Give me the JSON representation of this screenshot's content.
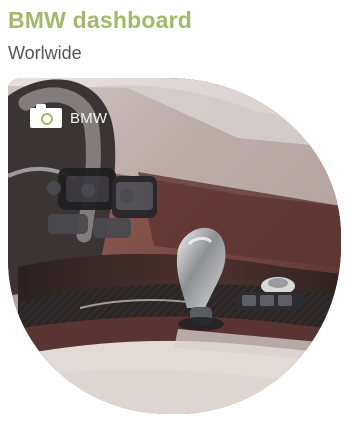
{
  "header": {
    "title": "BMW dashboard",
    "subtitle": "Worlwide"
  },
  "photo": {
    "credit": "BMW",
    "icon": "camera-icon",
    "accent_color": "#a4b86a",
    "tint_color": "#6a3f3a"
  }
}
